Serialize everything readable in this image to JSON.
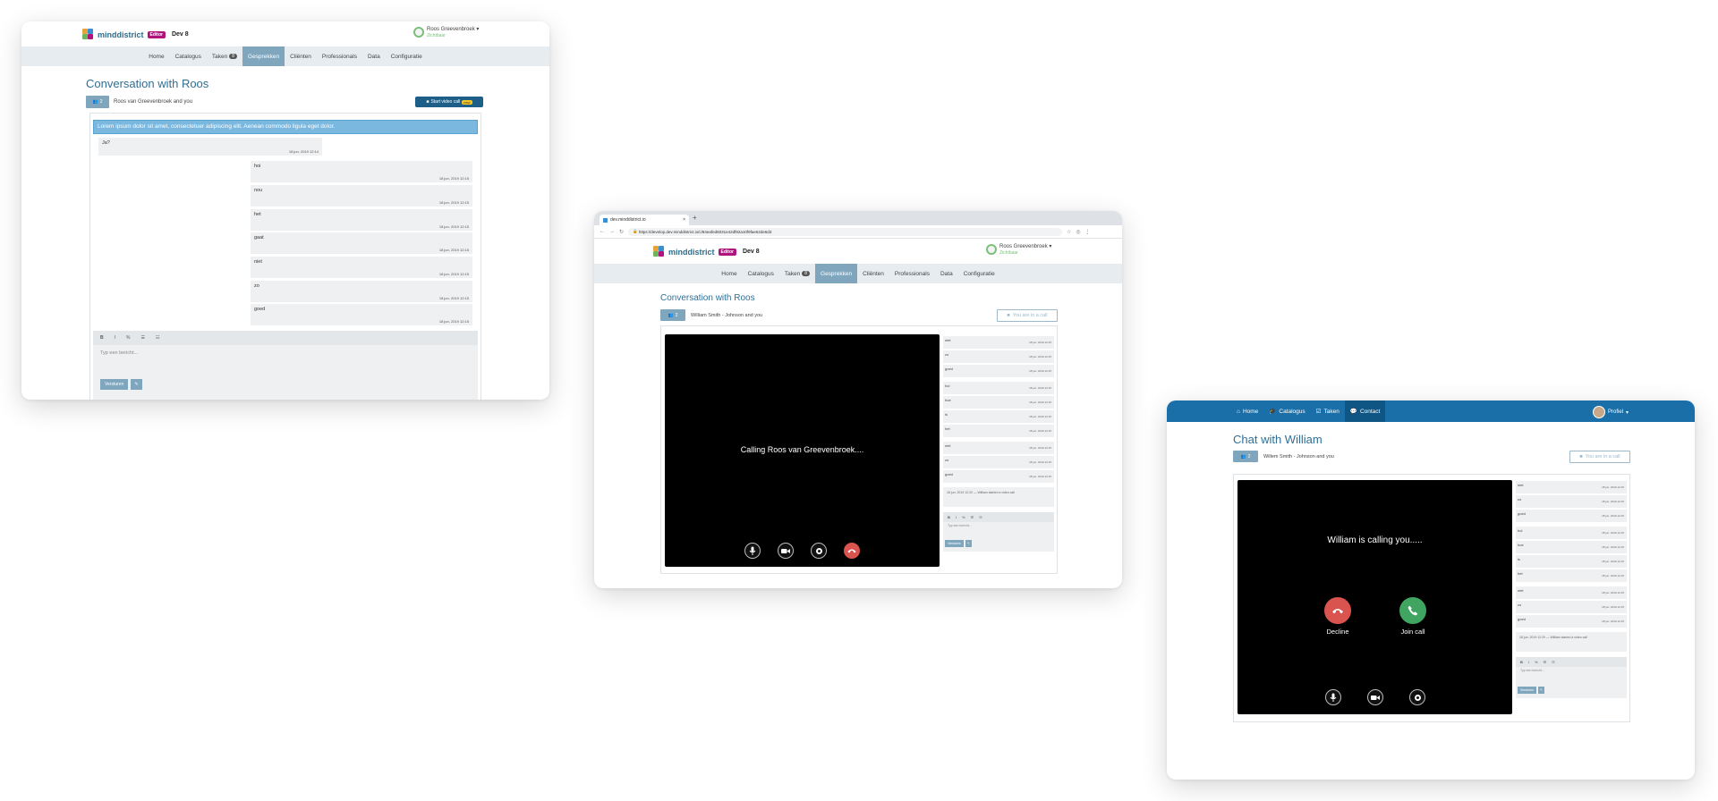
{
  "shared": {
    "brand": "minddistrict",
    "edit_badge": "Editor",
    "env_label": "Dev 8",
    "user_name": "Roos Greevenbroek",
    "user_status": "Zichtbaar",
    "nav": [
      "Home",
      "Catalogus",
      "Taken",
      "Gesprekken",
      "Cliënten",
      "Professionals",
      "Data",
      "Configuratie"
    ],
    "tasks_count": "8",
    "active_nav": "Gesprekken",
    "colors": {
      "accent": "#2e6f96",
      "nav_active": "#7fa6bd",
      "decline": "#d9534f",
      "accept": "#3fa561",
      "brand_bar": "#1a6fa8"
    }
  },
  "screen1": {
    "title": "Conversation with Roos",
    "participants_count": "2",
    "participants_text": "Roos van Greevenbroek and you",
    "video_button": "Start video call",
    "new_badge": "new",
    "banner": "Lorem ipsum dolor sit amet, consectetuer adipiscing elit. Aenean commodo ligula eget dolor.",
    "first_msg": {
      "text": "Ja?",
      "time": "18 jun. 2019 12:14"
    },
    "messages": [
      {
        "text": "hoi",
        "time": "18 jun. 2019 12:15"
      },
      {
        "text": "nou",
        "time": "18 jun. 2019 12:15"
      },
      {
        "text": "het",
        "time": "18 jun. 2019 12:15"
      },
      {
        "text": "gaat",
        "time": "18 jun. 2019 12:15"
      },
      {
        "text": "niet",
        "time": "18 jun. 2019 12:15"
      },
      {
        "text": "zo",
        "time": "18 jun. 2019 12:15"
      },
      {
        "text": "goed",
        "time": "18 jun. 2019 12:15"
      }
    ],
    "toolbar": [
      "B",
      "I",
      "%",
      "☰",
      "☷"
    ],
    "compose_placeholder": "Typ een bericht...",
    "send": "Versturen",
    "attach": "✎"
  },
  "screen2": {
    "tab_title": "dev.minddistrict.io",
    "url": "https://develop.dev.minddistrict.io/c/84eafed6031e42df82a10f9fae62de6d3",
    "title": "Conversation with Roos",
    "participants_count": "2",
    "participants_text": "William Smith - Johnson and you",
    "in_call": "You are in a call",
    "calling_text": "Calling Roos van Greevenbroek....",
    "side_msgs": [
      {
        "text": "niet",
        "time": "18 jun. 2019 12:15"
      },
      {
        "text": "zo",
        "time": "18 jun. 2019 12:15"
      },
      {
        "text": "goed",
        "time": "18 jun. 2019 12:15"
      },
      {
        "text": "hoi",
        "time": "18 jun. 2019 12:15"
      },
      {
        "text": "hoe",
        "time": "18 jun. 2019 12:15"
      },
      {
        "text": "is",
        "time": "18 jun. 2019 12:15"
      },
      {
        "text": "het",
        "time": "18 jun. 2019 12:15"
      },
      {
        "text": "niet",
        "time": "18 jun. 2019 12:15"
      },
      {
        "text": "zo",
        "time": "18 jun. 2019 12:15"
      },
      {
        "text": "goed",
        "time": "18 jun. 2019 12:15"
      }
    ],
    "system_msg": "18 jun. 2019 12:20 — William started a video call",
    "compose_placeholder": "Typ een bericht...",
    "send": "Versturen"
  },
  "screen3": {
    "nav": [
      "Home",
      "Catalogus",
      "Taken",
      "Contact"
    ],
    "profile": "Profiel",
    "title": "Chat with William",
    "participants_count": "2",
    "participants_text": "Willem Smith - Johnson and you",
    "in_call": "You are in a call",
    "calling_text": "William is calling you.....",
    "decline": "Decline",
    "join": "Join call",
    "side_msgs": [
      {
        "text": "niet",
        "time": "18 jun. 2019 12:15"
      },
      {
        "text": "zo",
        "time": "18 jun. 2019 12:15"
      },
      {
        "text": "goed",
        "time": "18 jun. 2019 12:15"
      },
      {
        "text": "hoi",
        "time": "18 jun. 2019 12:15"
      },
      {
        "text": "hoe",
        "time": "18 jun. 2019 12:15"
      },
      {
        "text": "is",
        "time": "18 jun. 2019 12:15"
      },
      {
        "text": "het",
        "time": "18 jun. 2019 12:15"
      },
      {
        "text": "niet",
        "time": "18 jun. 2019 12:15"
      },
      {
        "text": "zo",
        "time": "18 jun. 2019 12:15"
      },
      {
        "text": "goed",
        "time": "18 jun. 2019 12:15"
      }
    ],
    "system_msg": "18 jun. 2019 12:20 — William started a video call",
    "compose_placeholder": "Typ een bericht...",
    "send": "Versturen"
  }
}
